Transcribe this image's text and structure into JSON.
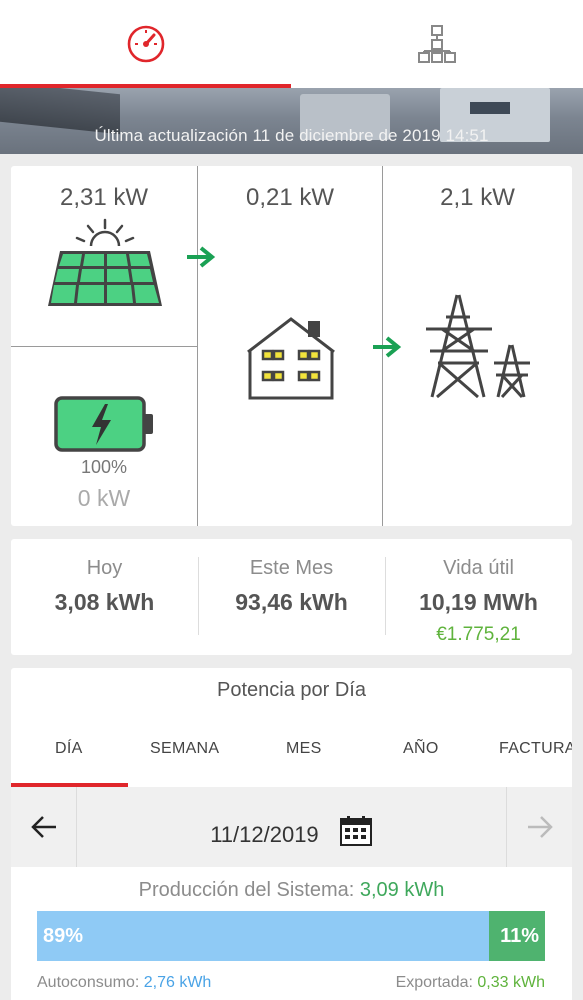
{
  "tabs": [
    {
      "label": "",
      "icon": "gauge-icon",
      "active": true
    },
    {
      "label": "",
      "icon": "network-layout-icon",
      "active": false
    }
  ],
  "banner": {
    "last_update": "Última actualización 11 de diciembre de 2019 14:51"
  },
  "flow": {
    "solar": {
      "power": "2,31 kW",
      "icon": "solar-panel-icon"
    },
    "battery": {
      "charge": "100%",
      "power": "0 kW",
      "icon": "battery-charging-icon",
      "level": 1.0
    },
    "home": {
      "power": "0,21 kW",
      "icon": "house-icon"
    },
    "grid": {
      "power": "2,1 kW",
      "icon": "power-tower-icon"
    },
    "arrow_color": "#1aa154"
  },
  "stats": {
    "today": {
      "label": "Hoy",
      "value": "3,08 kWh"
    },
    "month": {
      "label": "Este Mes",
      "value": "93,46 kWh"
    },
    "lifetime": {
      "label": "Vida útil",
      "value": "10,19 MWh",
      "money": "€1.775,21"
    }
  },
  "power": {
    "title": "Potencia por Día",
    "tabs": [
      "DÍA",
      "SEMANA",
      "MES",
      "AÑO",
      "FACTURA"
    ],
    "active_tab": "DÍA",
    "date": "11/12/2019",
    "production_label": "Producción del Sistema:",
    "production_value": "3,09 kWh",
    "self_pct": "89%",
    "export_pct": "11%",
    "self_fraction": 0.89,
    "self_label": "Autoconsumo:",
    "self_value": "2,76 kWh",
    "export_label": "Exportada:",
    "export_value": "0,33 kWh",
    "colors": {
      "accent": "#e0262b",
      "self": "#8fcaf5",
      "export": "#4fb36f"
    }
  }
}
